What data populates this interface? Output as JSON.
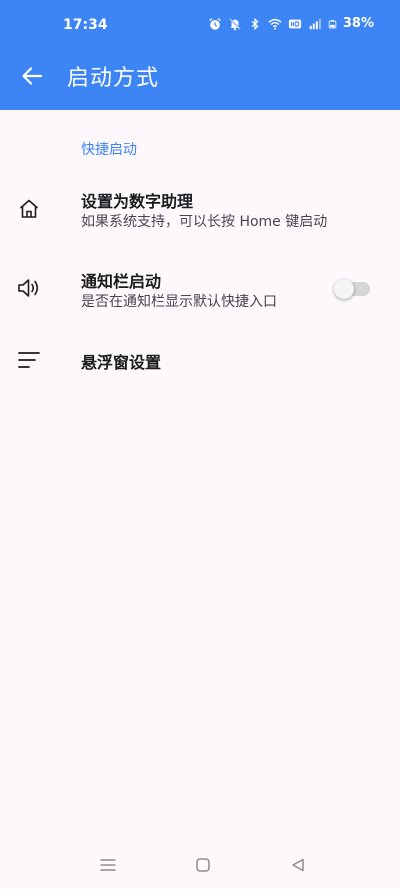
{
  "status_bar": {
    "time": "17:34",
    "battery": "38%"
  },
  "app_bar": {
    "title": "启动方式",
    "color": "#3D85F5"
  },
  "section": {
    "header": "快捷启动"
  },
  "items": [
    {
      "icon": "home-icon",
      "title": "设置为数字助理",
      "subtitle": "如果系统支持，可以长按 Home 键启动"
    },
    {
      "icon": "speaker-icon",
      "title": "通知栏启动",
      "subtitle": "是否在通知栏显示默认快捷入口",
      "toggle_on": false
    },
    {
      "icon": "menu-lines-icon",
      "title": "悬浮窗设置"
    }
  ],
  "colors": {
    "accent": "#3D85F5",
    "background": "#FDF8FC"
  }
}
